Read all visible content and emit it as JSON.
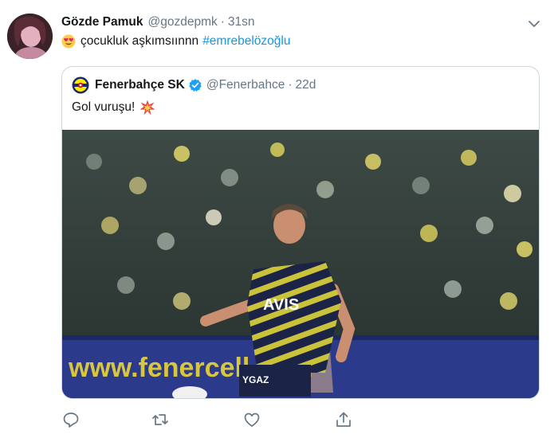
{
  "tweet": {
    "name": "Gözde Pamuk",
    "handle": "@gozdepmk",
    "separator": "·",
    "time": "31sn",
    "text": "çocukluk aşkımsıınnn",
    "hashtag": "#emrebelözoğlu",
    "emoji": "heart-eyes-emoji"
  },
  "quoted": {
    "name": "Fenerbahçe SK",
    "handle": "@Fenerbahce",
    "separator": "·",
    "time": "22d",
    "text": "Gol vuruşu!",
    "media": {
      "jersey_sponsor": "AVIS",
      "shorts_sponsor": "YGAZ",
      "ad_board_text": "www.fenercell.com"
    }
  },
  "actions": [
    "reply-icon",
    "retweet-icon",
    "like-icon",
    "share-icon"
  ],
  "colors": {
    "link": "#1b95e0",
    "muted": "#657786",
    "border": "#ccd6dd",
    "verified": "#1da1f2"
  }
}
